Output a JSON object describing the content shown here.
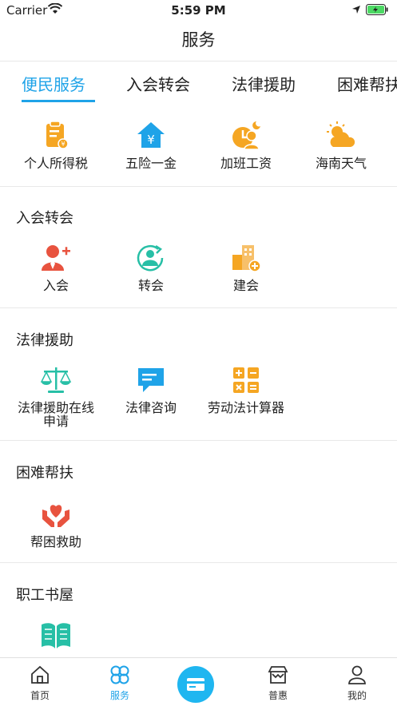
{
  "status_bar": {
    "carrier": "Carrier",
    "time": "5:59 PM"
  },
  "header": {
    "title": "服务"
  },
  "tabs": [
    {
      "label": "便民服务",
      "active": true
    },
    {
      "label": "入会转会"
    },
    {
      "label": "法律援助"
    },
    {
      "label": "困难帮扶"
    }
  ],
  "services": {
    "items": [
      {
        "label": "个人所得税",
        "icon": "tax-receipt-icon"
      },
      {
        "label": "五险一金",
        "icon": "house-yuan-icon"
      },
      {
        "label": "加班工资",
        "icon": "overtime-clock-icon"
      },
      {
        "label": "海南天气",
        "icon": "weather-icon"
      }
    ]
  },
  "membership": {
    "title": "入会转会",
    "items": [
      {
        "label": "入会",
        "icon": "add-user-icon"
      },
      {
        "label": "转会",
        "icon": "transfer-user-icon"
      },
      {
        "label": "建会",
        "icon": "building-add-icon"
      }
    ]
  },
  "legal_aid": {
    "title": "法律援助",
    "items": [
      {
        "label": "法律援助在线申请",
        "icon": "scales-icon"
      },
      {
        "label": "法律咨询",
        "icon": "chat-icon"
      },
      {
        "label": "劳动法计算器",
        "icon": "calculator-icon"
      }
    ]
  },
  "hardship": {
    "title": "困难帮扶",
    "items": [
      {
        "label": "帮困救助",
        "icon": "heart-hands-icon"
      }
    ]
  },
  "library": {
    "title": "职工书屋",
    "items": [
      {
        "icon": "book-icon"
      }
    ]
  },
  "tabbar": {
    "items": [
      {
        "label": "首页",
        "icon": "home-icon"
      },
      {
        "label": "服务",
        "icon": "clover-icon",
        "active": true
      },
      {
        "label": "",
        "icon": "card-icon"
      },
      {
        "label": "普惠",
        "icon": "store-icon"
      },
      {
        "label": "我的",
        "icon": "user-icon"
      }
    ]
  },
  "colors": {
    "accent": "#1fa3e8",
    "orange": "#f5a623",
    "red": "#e8533f",
    "teal": "#27bfa6",
    "sky": "#1fb6f0"
  }
}
